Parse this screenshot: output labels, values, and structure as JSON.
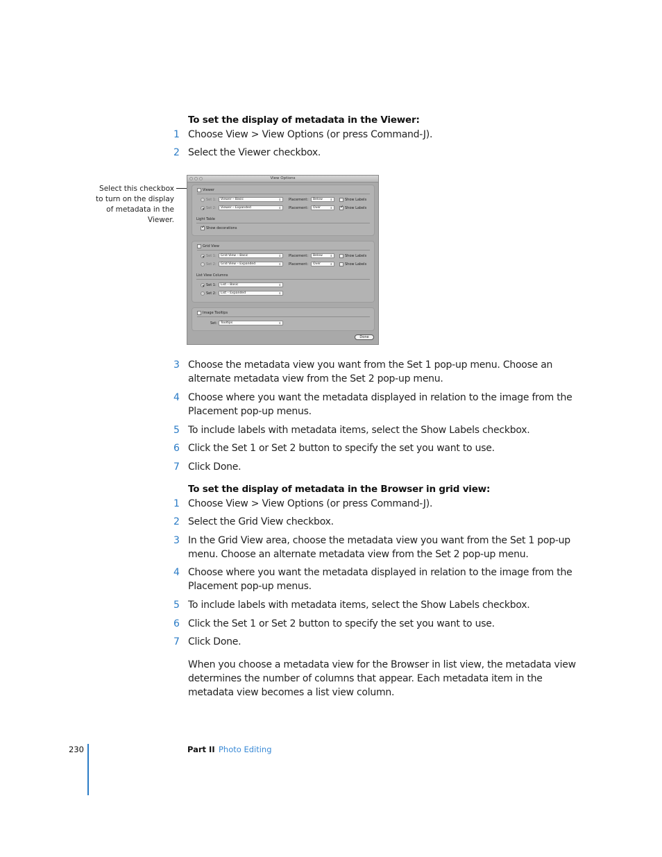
{
  "section1": {
    "heading": "To set the display of metadata in the Viewer:",
    "steps_before": [
      {
        "num": "1",
        "text": "Choose View > View Options (or press Command-J)."
      },
      {
        "num": "2",
        "text": "Select the Viewer checkbox."
      }
    ],
    "steps_after": [
      {
        "num": "3",
        "text": "Choose the metadata view you want from the Set 1 pop-up menu. Choose an alternate metadata view from the Set 2 pop-up menu."
      },
      {
        "num": "4",
        "text": "Choose where you want the metadata displayed in relation to the image from the Placement pop-up menus."
      },
      {
        "num": "5",
        "text": "To include labels with metadata items, select the Show Labels checkbox."
      },
      {
        "num": "6",
        "text": "Click the Set 1 or Set 2 button to specify the set you want to use."
      },
      {
        "num": "7",
        "text": "Click Done."
      }
    ]
  },
  "callout": "Select this checkbox to turn on the display of metadata in the Viewer.",
  "dialog": {
    "title": "View Options",
    "viewer": {
      "label": "Viewer",
      "checked": false,
      "set1_label": "Set 1:",
      "set1_value": "Viewer – Basic",
      "set2_label": "Set 2:",
      "set2_value": "Viewer – Expanded",
      "placement_label": "Placement:",
      "placement1": "Below",
      "placement2": "Over",
      "show_labels": "Show Labels"
    },
    "light_table": {
      "label": "Light Table",
      "show_decorations": "Show decorations"
    },
    "grid_view": {
      "label": "Grid View",
      "set1_label": "Set 1:",
      "set1_value": "Grid View – Basic",
      "set2_label": "Set 2:",
      "set2_value": "Grid View – Expanded",
      "placement_label": "Placement:",
      "placement1": "Below",
      "placement2": "Over",
      "show_labels": "Show Labels"
    },
    "list_view": {
      "label": "List View Columns",
      "set1_label": "Set 1:",
      "set1_value": "List – Basic",
      "set2_label": "Set 2:",
      "set2_value": "List – Expanded"
    },
    "tooltips": {
      "label": "Image Tooltips",
      "set_label": "Set:",
      "set_value": "Tooltips"
    },
    "done": "Done"
  },
  "section2": {
    "heading": "To set the display of metadata in the Browser in grid view:",
    "steps": [
      {
        "num": "1",
        "text": "Choose View > View Options (or press Command-J)."
      },
      {
        "num": "2",
        "text": "Select the Grid View checkbox."
      },
      {
        "num": "3",
        "text": "In the Grid View area, choose the metadata view you want from the Set 1 pop-up menu. Choose an alternate metadata view from the Set 2 pop-up menu."
      },
      {
        "num": "4",
        "text": "Choose where you want the metadata displayed in relation to the image from the Placement pop-up menus."
      },
      {
        "num": "5",
        "text": "To include labels with metadata items, select the Show Labels checkbox."
      },
      {
        "num": "6",
        "text": "Click the Set 1 or Set 2 button to specify the set you want to use."
      },
      {
        "num": "7",
        "text": "Click Done."
      }
    ],
    "note": "When you choose a metadata view for the Browser in list view, the metadata view determines the number of columns that appear. Each metadata item in the metadata view becomes a list view column."
  },
  "footer": {
    "page_number": "230",
    "part": "Part II",
    "chapter": "Photo Editing"
  }
}
